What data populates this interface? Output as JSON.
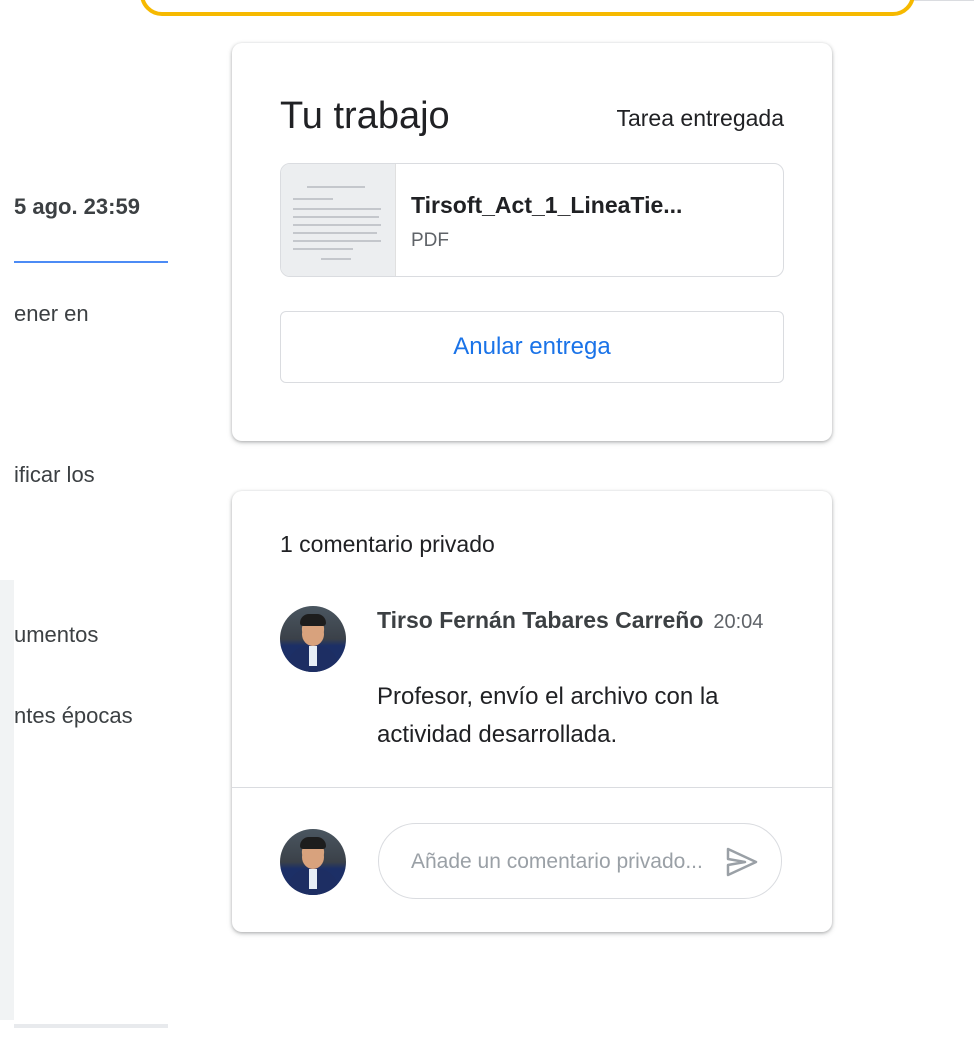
{
  "left_column": {
    "due_date": "5 ago. 23:59",
    "lines": [
      "ener en",
      "ificar los",
      "umentos",
      "ntes épocas"
    ]
  },
  "work_card": {
    "title": "Tu trabajo",
    "status": "Tarea entregada",
    "attachment": {
      "name": "Tirsoft_Act_1_LineaTie...",
      "type": "PDF"
    },
    "unsubmit_label": "Anular entrega"
  },
  "comments_card": {
    "title": "1 comentario privado",
    "comments": [
      {
        "author": "Tirso Fernán Tabares Carreño",
        "time": "20:04",
        "text": "Profesor, envío el archivo con la actividad desarrollada."
      }
    ],
    "input_placeholder": "Añade un comentario privado..."
  },
  "colors": {
    "accent": "#1a73e8",
    "highlight": "#f6b900"
  },
  "icons": {
    "send": "send-icon"
  }
}
